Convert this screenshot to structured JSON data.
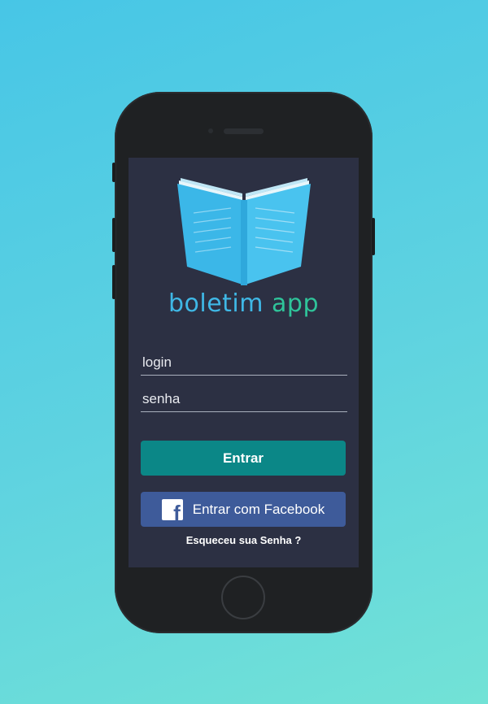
{
  "app": {
    "name_part1": "boletim",
    "name_part2": "app"
  },
  "form": {
    "login_placeholder": "login",
    "password_placeholder": "senha",
    "submit_label": "Entrar",
    "facebook_label": "Entrar com Facebook",
    "forgot_password_label": "Esqueceu sua Senha ?"
  },
  "icons": {
    "logo": "open-book-icon",
    "facebook": "facebook-icon"
  },
  "colors": {
    "background_top": "#47c6e6",
    "background_bottom": "#72e2d6",
    "screen_bg": "#2c3043",
    "primary_button": "#0b8787",
    "facebook_button": "#3e5b9a",
    "brand_blue": "#3fb8e6",
    "brand_green": "#2fc49a"
  }
}
